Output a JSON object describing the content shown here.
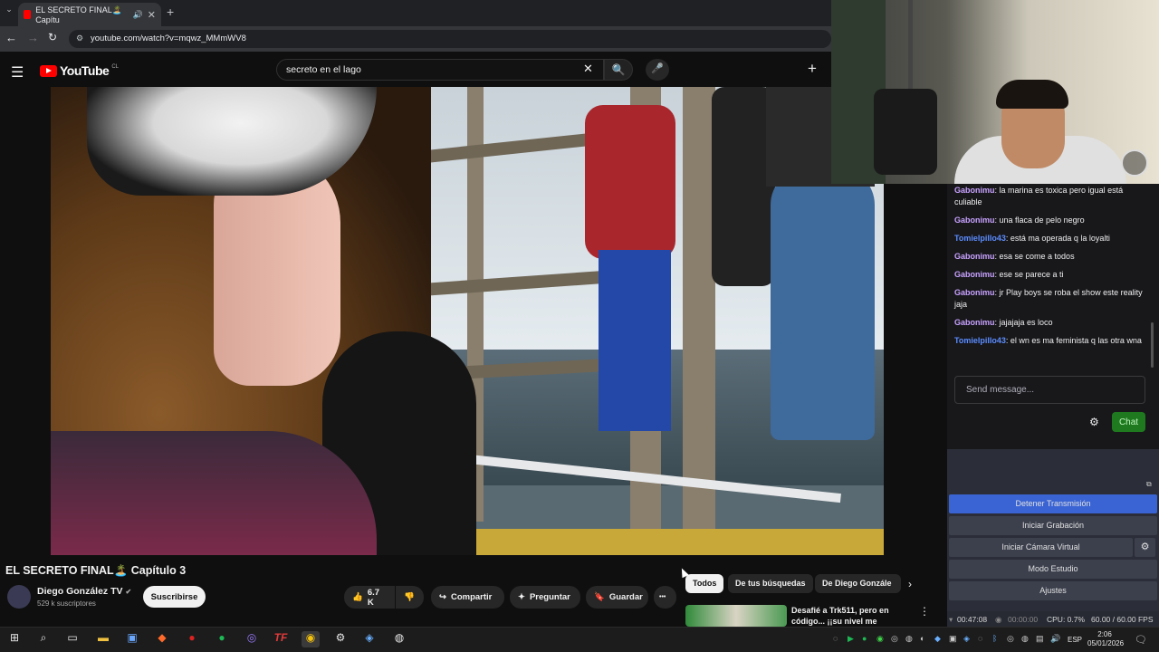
{
  "browser": {
    "tab_title": "EL SECRETO FINAL🏝️ Capítu",
    "new_tab": "+",
    "tab_close": "✕",
    "url": "youtube.com/watch?v=mqwz_MMmWV8"
  },
  "youtube": {
    "logo_text": "YouTube",
    "region": "CL",
    "search_value": "secreto en el lago",
    "video": {
      "title": "EL SECRETO FINAL🏝️ Capítulo 3",
      "channel": "Diego González TV",
      "verified": "✔",
      "subscribers": "529 k suscriptores",
      "subscribe_label": "Suscribirse",
      "likes": "6.7 K",
      "share_label": "Compartir",
      "ask_label": "Preguntar",
      "save_label": "Guardar",
      "more_label": "•••"
    },
    "chips": [
      "Todos",
      "De tus búsquedas",
      "De Diego Gonzále"
    ],
    "recommendation": {
      "title": "Desafié a Trk511, pero en código... ¡¡su nivel me"
    }
  },
  "chat": {
    "messages": [
      {
        "user": "Gabonimu",
        "text": "la marina es toxica pero igual está culiable",
        "color": "#c8a2ff"
      },
      {
        "user": "Gabonimu",
        "text": "una flaca de pelo negro",
        "color": "#c8a2ff"
      },
      {
        "user": "Tomielpillo43",
        "text": "está ma operada q la loyalti",
        "color": "#5b8cff"
      },
      {
        "user": "Gabonimu",
        "text": "esa se come a todos",
        "color": "#c8a2ff"
      },
      {
        "user": "Gabonimu",
        "text": "ese se parece a ti",
        "color": "#c8a2ff"
      },
      {
        "user": "Gabonimu",
        "text": "jr Play boys se roba el show este reality jaja",
        "color": "#c8a2ff"
      },
      {
        "user": "Gabonimu",
        "text": "jajajaja es loco",
        "color": "#c8a2ff"
      },
      {
        "user": "Tomielpillo43",
        "text": "el wn es ma feminista q las otra wna",
        "color": "#5b8cff"
      }
    ],
    "placeholder": "Send message...",
    "chat_button": "Chat"
  },
  "obs": {
    "buttons": {
      "stop_stream": "Detener Transmisión",
      "start_recording": "Iniciar Grabación",
      "start_vcam": "Iniciar Cámara Virtual",
      "studio_mode": "Modo Estudio",
      "settings": "Ajustes"
    },
    "status": {
      "live_time": "00:47:08",
      "rec_time": "00:00:00",
      "cpu": "CPU: 0.7%",
      "fps": "60.00 / 60.00 FPS"
    }
  },
  "taskbar": {
    "lang": "ESP",
    "time": "2:06",
    "date": "05/01/2026"
  }
}
